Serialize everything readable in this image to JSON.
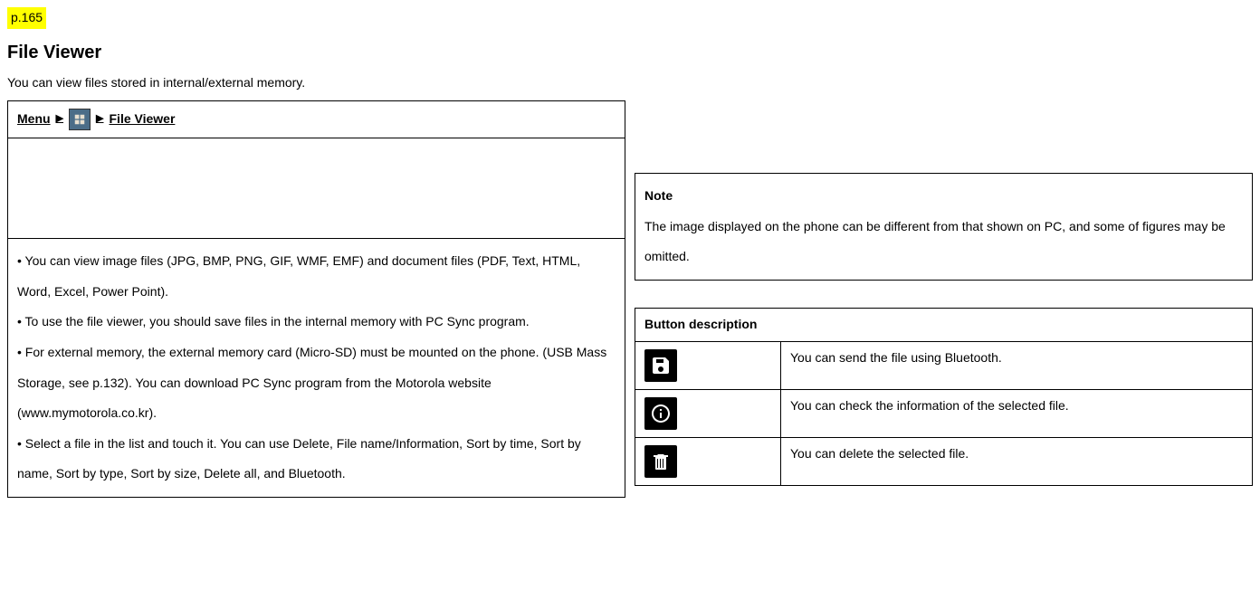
{
  "page_label": "p.165",
  "title": "File Viewer",
  "intro": "You can view files stored in internal/external memory.",
  "nav": {
    "item1": "Menu",
    "item2": "File Viewer"
  },
  "bullets": {
    "b1": "• You can view image files (JPG, BMP, PNG, GIF, WMF, EMF) and document files (PDF, Text, HTML, Word, Excel, Power Point).",
    "b2": "• To use the file viewer, you should save files in the internal memory with PC Sync program.",
    "b3": "• For external memory, the external memory card (Micro-SD) must be mounted on the phone. (USB Mass Storage, see p.132). You can download PC Sync program from the Motorola website (www.mymotorola.co.kr).",
    "b4": "• Select a file in the list and touch it. You can use Delete, File name/Information, Sort by time, Sort by name, Sort by type, Sort by size, Delete all, and Bluetooth."
  },
  "note": {
    "title": "Note",
    "text": "The image displayed on the phone can be different from that shown on PC, and some of figures may be omitted."
  },
  "button_desc": {
    "header": "Button description",
    "row1": "You can send the file using Bluetooth.",
    "row2": "You can check the information of the selected file.",
    "row3": "You can delete the selected file."
  }
}
